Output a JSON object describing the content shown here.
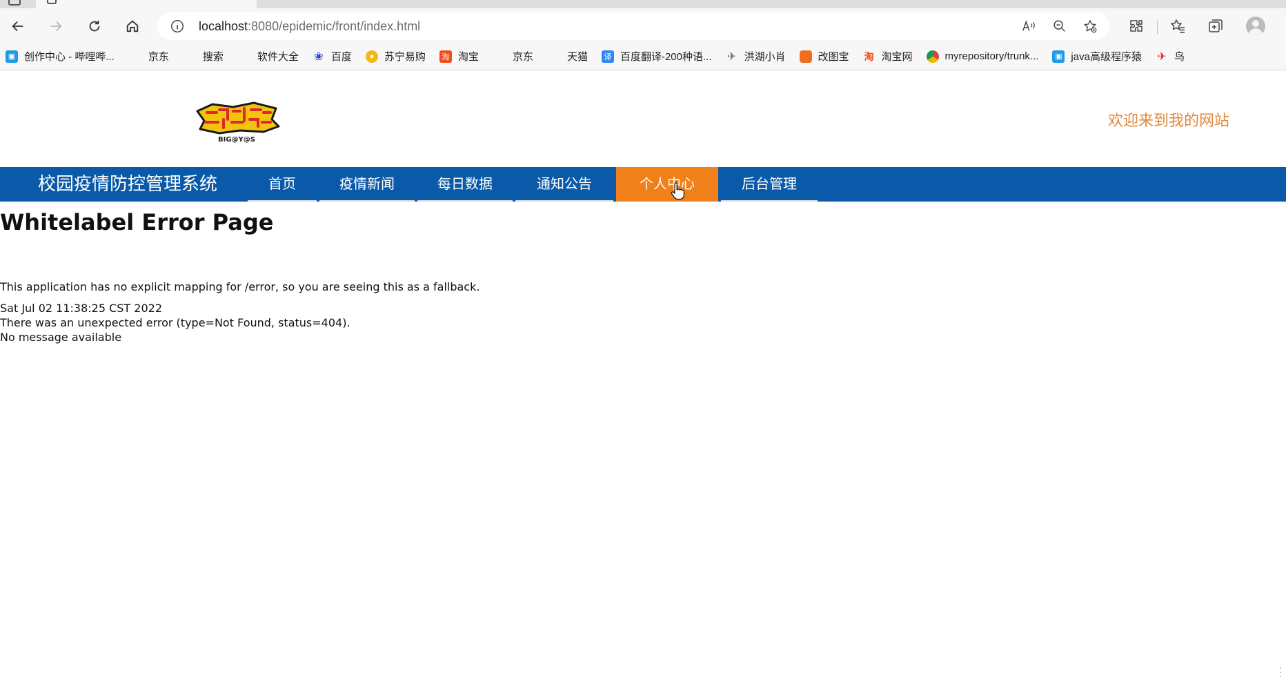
{
  "browser": {
    "url_host": "localhost",
    "url_path": ":8080/epidemic/front/index.html",
    "bookmarks": [
      {
        "label": "创作中心 - 哔哩哔...",
        "icon": "bilibili-icon",
        "color": "#1e9be8"
      },
      {
        "label": "京东",
        "icon": "page-icon"
      },
      {
        "label": "搜索",
        "icon": "page-icon"
      },
      {
        "label": "软件大全",
        "icon": "page-icon"
      },
      {
        "label": "百度",
        "icon": "baidu-paw-icon",
        "color": "#2b3ecf"
      },
      {
        "label": "苏宁易购",
        "icon": "suning-icon",
        "color": "#f5b915"
      },
      {
        "label": "淘宝",
        "icon": "taobao-icon",
        "color": "#f24d1c"
      },
      {
        "label": "京东",
        "icon": "page-icon"
      },
      {
        "label": "天猫",
        "icon": "page-icon"
      },
      {
        "label": "百度翻译-200种语...",
        "icon": "translate-icon",
        "color": "#2f86f6"
      },
      {
        "label": "洪湖小肖",
        "icon": "bird-icon",
        "color": "#6b6b6b"
      },
      {
        "label": "改图宝",
        "icon": "gaitubao-icon",
        "color": "#f36d21"
      },
      {
        "label": "淘宝网",
        "icon": "taobao-icon",
        "color": "#f24d1c"
      },
      {
        "label": "myrepository/trunk...",
        "icon": "chrome-icon",
        "color": "#3f8d3f"
      },
      {
        "label": "java高级程序猿",
        "icon": "bilibili-icon",
        "color": "#1e9be8"
      },
      {
        "label": "鸟",
        "icon": "red-bird-icon",
        "color": "#e02525"
      }
    ]
  },
  "site": {
    "logo_text": "BIG@Y@S",
    "welcome": "欢迎来到我的网站",
    "brand": "校园疫情防控管理系统",
    "menu": [
      {
        "label": "首页",
        "active": false
      },
      {
        "label": "疫情新闻",
        "active": false
      },
      {
        "label": "每日数据",
        "active": false
      },
      {
        "label": "通知公告",
        "active": false
      },
      {
        "label": "个人中心",
        "active": true
      },
      {
        "label": "后台管理",
        "active": false
      }
    ],
    "colors": {
      "nav": "#0a5aa9",
      "active": "#f08019",
      "welcome": "#e0893a"
    }
  },
  "error": {
    "title": "Whitelabel Error Page",
    "description": "This application has no explicit mapping for /error, so you are seeing this as a fallback.",
    "timestamp": "Sat Jul 02 11:38:25 CST 2022",
    "detail": "There was an unexpected error (type=Not Found, status=404).",
    "message": "No message available"
  }
}
